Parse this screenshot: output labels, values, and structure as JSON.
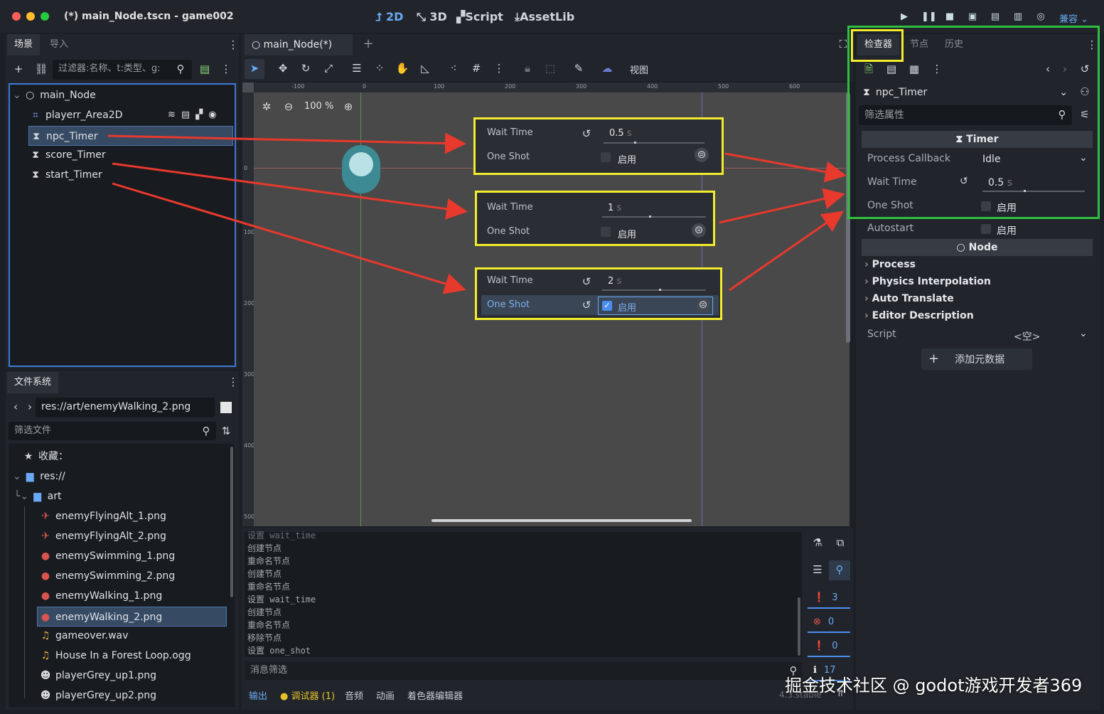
{
  "window": {
    "title": "(*) main_Node.tscn - game002",
    "modes": [
      "2D",
      "3D",
      "Script",
      "AssetLib"
    ],
    "renderer": "兼容"
  },
  "scene_panel": {
    "tabs": [
      "场景",
      "导入"
    ],
    "filter_placeholder": "过滤器:名称、t:类型、g:",
    "nodes": [
      {
        "label": "main_Node",
        "icon": "node-circle-icon"
      },
      {
        "label": "playerr_Area2D",
        "icon": "area2d-icon"
      },
      {
        "label": "npc_Timer",
        "icon": "hourglass-icon"
      },
      {
        "label": "score_Timer",
        "icon": "hourglass-icon"
      },
      {
        "label": "start_Timer",
        "icon": "hourglass-icon"
      }
    ]
  },
  "filesystem": {
    "tab": "文件系统",
    "path": "res://art/enemyWalking_2.png",
    "filter_placeholder": "筛选文件",
    "favorites": "收藏：",
    "root": "res://",
    "folder": "art",
    "files": [
      "enemyFlyingAlt_1.png",
      "enemyFlyingAlt_2.png",
      "enemySwimming_1.png",
      "enemySwimming_2.png",
      "enemyWalking_1.png",
      "enemyWalking_2.png",
      "gameover.wav",
      "House In a Forest Loop.ogg",
      "playerGrey_up1.png",
      "playerGrey_up2.png"
    ]
  },
  "editor": {
    "tab": "main_Node(*)",
    "view_menu": "视图",
    "zoom": "100 %",
    "ruler_ticks": [
      "-100",
      "0",
      "100",
      "200",
      "300",
      "400",
      "500",
      "600"
    ],
    "vruler_ticks": [
      "0",
      "100",
      "200",
      "300",
      "400",
      "500"
    ]
  },
  "callouts": [
    {
      "wait_label": "Wait Time",
      "wait_value": "0.5",
      "unit": "s",
      "oneshot_label": "One Shot",
      "enabled": "启用",
      "checked": false,
      "slider": 0.3
    },
    {
      "wait_label": "Wait Time",
      "wait_value": "1",
      "unit": "s",
      "oneshot_label": "One Shot",
      "enabled": "启用",
      "checked": false,
      "slider": 0.45
    },
    {
      "wait_label": "Wait Time",
      "wait_value": "2",
      "unit": "s",
      "oneshot_label": "One Shot",
      "enabled": "启用",
      "checked": true,
      "slider": 0.55
    }
  ],
  "output": {
    "lines": [
      "设置 wait_time",
      "创建节点",
      "重命名节点",
      "创建节点",
      "重命名节点",
      "设置 wait_time",
      "创建节点",
      "重命名节点",
      "移除节点",
      "设置 one_shot"
    ],
    "filter_placeholder": "消息筛选",
    "counters": [
      "3",
      "0",
      "0",
      "17"
    ],
    "tabs": [
      "输出",
      "调试器 (1)",
      "音频",
      "动画",
      "着色器编辑器"
    ],
    "version": "4.3.stable"
  },
  "inspector": {
    "tabs": [
      "检查器",
      "节点",
      "历史"
    ],
    "node_name": "npc_Timer",
    "filter_placeholder": "筛选属性",
    "section_timer": "Timer",
    "process_callback_label": "Process Callback",
    "process_callback_value": "Idle",
    "wait_time_label": "Wait Time",
    "wait_time_value": "0.5",
    "wait_time_unit": "s",
    "one_shot_label": "One Shot",
    "autostart_label": "Autostart",
    "enabled": "启用",
    "section_node": "Node",
    "groups": [
      "Process",
      "Physics Interpolation",
      "Auto Translate",
      "Editor Description"
    ],
    "script_label": "Script",
    "script_value": "<空>",
    "add_metadata": "添加元数据"
  },
  "watermark": "掘金技术社区 @ godot游戏开发者369",
  "colors": {
    "highlight_yellow": "#f2ec2c",
    "highlight_green": "#2fbf3f",
    "arrow_red": "#e8392d",
    "accent_blue": "#6aa9f5"
  }
}
